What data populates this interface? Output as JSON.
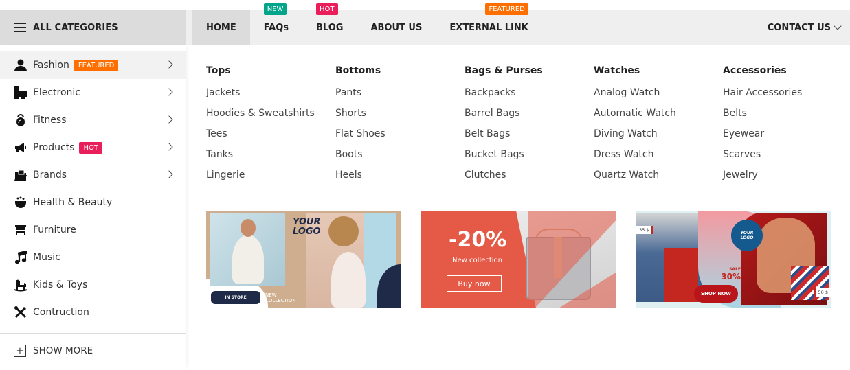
{
  "header": {
    "all_categories_label": "ALL CATEGORIES",
    "nav": [
      {
        "label": "HOME",
        "active": true,
        "badge": null
      },
      {
        "label": "FAQs",
        "active": false,
        "badge": {
          "text": "NEW",
          "color": "#00a58a"
        }
      },
      {
        "label": "BLOG",
        "active": false,
        "badge": {
          "text": "HOT",
          "color": "#e91e5a"
        }
      },
      {
        "label": "ABOUT US",
        "active": false,
        "badge": null
      },
      {
        "label": "EXTERNAL LINK",
        "active": false,
        "badge": {
          "text": "FEATURED",
          "color": "#ff6f00"
        }
      }
    ],
    "contact_label": "CONTACT US"
  },
  "sidebar": {
    "items": [
      {
        "label": "Fashion",
        "icon": "user-icon",
        "badge": {
          "text": "FEATURED",
          "color": "#ff6f00"
        },
        "has_submenu": true,
        "active": true
      },
      {
        "label": "Electronic",
        "icon": "computer-icon",
        "badge": null,
        "has_submenu": true,
        "active": false
      },
      {
        "label": "Fitness",
        "icon": "kettlebell-icon",
        "badge": null,
        "has_submenu": true,
        "active": false
      },
      {
        "label": "Products",
        "icon": "megaphone-icon",
        "badge": {
          "text": "HOT",
          "color": "#e91e5a"
        },
        "has_submenu": true,
        "active": false
      },
      {
        "label": "Brands",
        "icon": "folder-icon",
        "badge": null,
        "has_submenu": true,
        "active": false
      },
      {
        "label": "Health & Beauty",
        "icon": "bowl-icon",
        "badge": null,
        "has_submenu": false,
        "active": false
      },
      {
        "label": "Furniture",
        "icon": "dresser-icon",
        "badge": null,
        "has_submenu": false,
        "active": false
      },
      {
        "label": "Music",
        "icon": "music-note-icon",
        "badge": null,
        "has_submenu": false,
        "active": false
      },
      {
        "label": "Kids & Toys",
        "icon": "rocking-horse-icon",
        "badge": null,
        "has_submenu": false,
        "active": false
      },
      {
        "label": "Contruction",
        "icon": "tools-icon",
        "badge": null,
        "has_submenu": false,
        "active": false
      }
    ],
    "show_more_label": "SHOW MORE"
  },
  "mega_menu": {
    "columns": [
      {
        "title": "Tops",
        "links": [
          "Jackets",
          "Hoodies & Sweatshirts",
          "Tees",
          "Tanks",
          "Lingerie"
        ]
      },
      {
        "title": "Bottoms",
        "links": [
          "Pants",
          "Shorts",
          "Flat Shoes",
          "Boots",
          "Heels"
        ]
      },
      {
        "title": "Bags & Purses",
        "links": [
          "Backpacks",
          "Barrel Bags",
          "Belt Bags",
          "Bucket Bags",
          "Clutches"
        ]
      },
      {
        "title": "Watches",
        "links": [
          "Analog Watch",
          "Automatic Watch",
          "Diving Watch",
          "Dress Watch",
          "Quartz Watch"
        ]
      },
      {
        "title": "Accessories",
        "links": [
          "Hair Accessories",
          "Belts",
          "Eyewear",
          "Scarves",
          "Jewelry"
        ]
      }
    ],
    "banners": [
      {
        "logo_line1": "YOUR",
        "logo_line2": "LOGO",
        "button": "IN STORE",
        "caption_line1": "NEW",
        "caption_line2": "COLLECTION"
      },
      {
        "headline": "-20%",
        "subtitle": "New collection",
        "button": "Buy now"
      },
      {
        "logo_line1": "YOUR",
        "logo_line2": "LOGO",
        "sale_label": "SALE",
        "sale_value": "30%",
        "button": "SHOP NOW",
        "price_left": "35 $",
        "price_right": "50 $"
      }
    ]
  }
}
